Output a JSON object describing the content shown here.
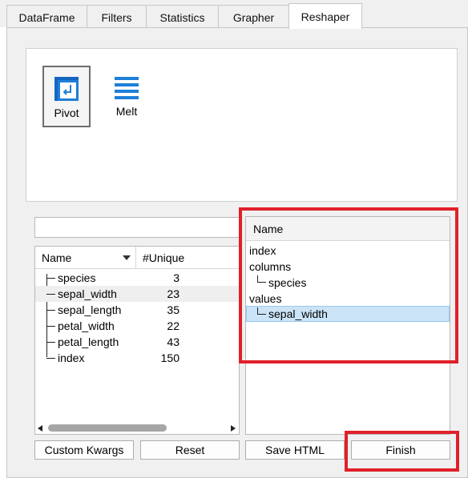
{
  "tabs": [
    {
      "label": "DataFrame"
    },
    {
      "label": "Filters"
    },
    {
      "label": "Statistics"
    },
    {
      "label": "Grapher"
    },
    {
      "label": "Reshaper"
    }
  ],
  "methods": [
    {
      "label": "Pivot",
      "icon": "pivot-icon",
      "selected": true
    },
    {
      "label": "Melt",
      "icon": "melt-icon",
      "selected": false
    }
  ],
  "search": {
    "value": "",
    "placeholder": ""
  },
  "columns_list": {
    "headers": {
      "name": "Name",
      "unique": "#Unique"
    },
    "rows": [
      {
        "name": "species",
        "unique": "3"
      },
      {
        "name": "sepal_width",
        "unique": "23"
      },
      {
        "name": "sepal_length",
        "unique": "35"
      },
      {
        "name": "petal_width",
        "unique": "22"
      },
      {
        "name": "petal_length",
        "unique": "43"
      },
      {
        "name": "index",
        "unique": "150"
      }
    ]
  },
  "config_tree": {
    "header": "Name",
    "items": [
      {
        "label": "index",
        "level": 0
      },
      {
        "label": "columns",
        "level": 0
      },
      {
        "label": "species",
        "level": 1
      },
      {
        "label": "values",
        "level": 0
      },
      {
        "label": "sepal_width",
        "level": 1,
        "selected": true
      }
    ]
  },
  "buttons": {
    "custom_kwargs": "Custom Kwargs",
    "reset": "Reset",
    "save_html": "Save HTML",
    "finish": "Finish"
  },
  "colors": {
    "accent": "#1e7fd8",
    "highlight": "#e0202a",
    "selection": "#cce4f7"
  }
}
